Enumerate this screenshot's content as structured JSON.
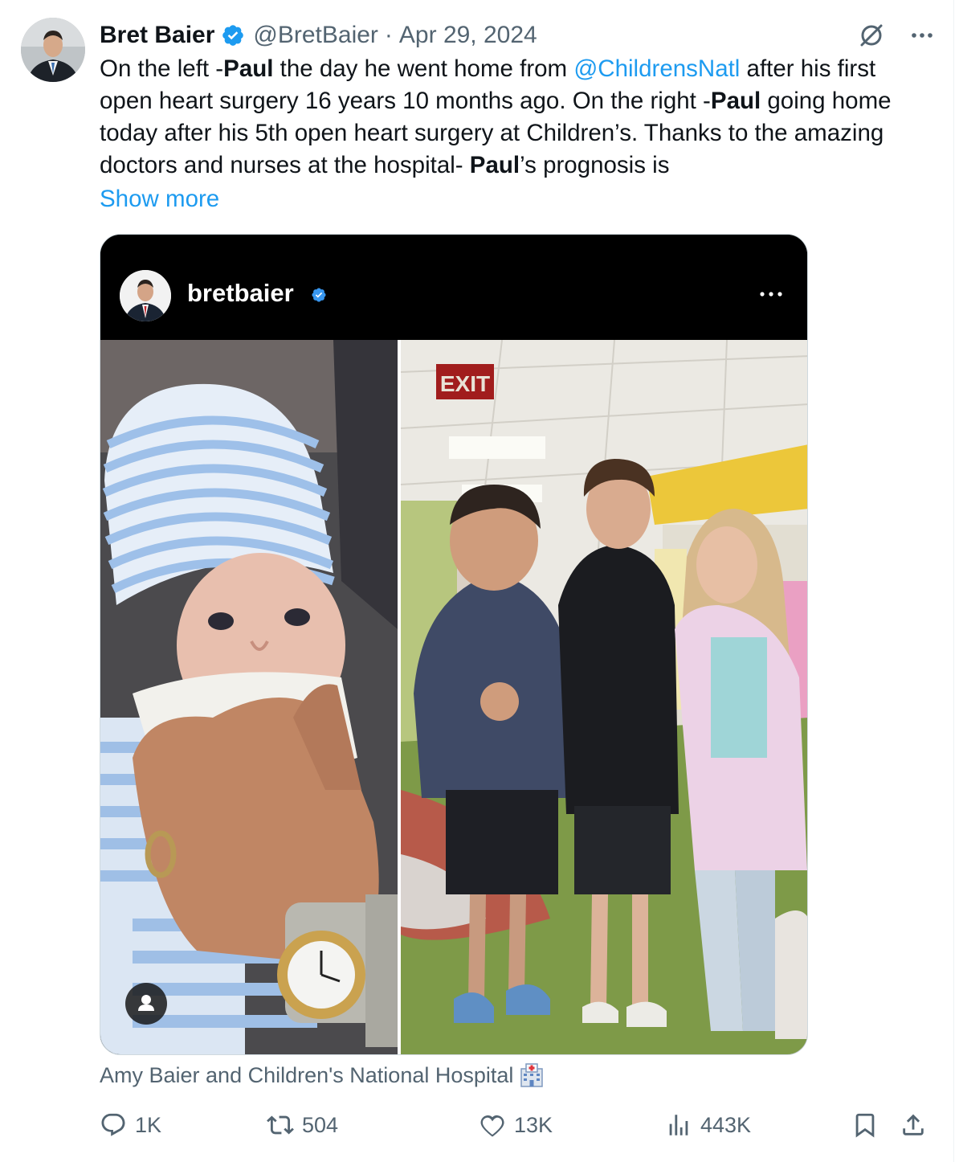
{
  "colors": {
    "accent": "#1d9bf0",
    "text_primary": "#0f1419",
    "text_secondary": "#536471"
  },
  "author": {
    "display_name": "Bret Baier",
    "handle": "@BretBaier",
    "separator": "·",
    "date": "Apr 29, 2024",
    "verified_icon": "verified-badge-icon"
  },
  "header_icons": [
    "grok-icon",
    "more-icon"
  ],
  "tweet": {
    "t1": "On the left -",
    "b1": "Paul",
    "t2": " the day he went home from ",
    "mention": "@ChildrensNatl",
    "t3": " after his first open heart surgery 16 years 10 months ago. On the right -",
    "b2": "Paul",
    "t4": " going home today after his 5th open heart surgery at Children’s. Thanks to the amazing doctors and nurses at the hospital- ",
    "b3": "Paul",
    "t5": "’s prognosis is",
    "show_more": "Show more"
  },
  "media": {
    "ig_name": "bretbaier",
    "photo_left": "baby-in-striped-hat-photo",
    "photo_right": "family-in-hospital-hallway-photo",
    "exit_sign": "EXIT"
  },
  "caption": {
    "text": "Amy Baier and Children's National Hospital",
    "icon": "hospital-icon"
  },
  "actions": {
    "replies": "1K",
    "reposts": "504",
    "likes": "13K",
    "views": "443K"
  }
}
